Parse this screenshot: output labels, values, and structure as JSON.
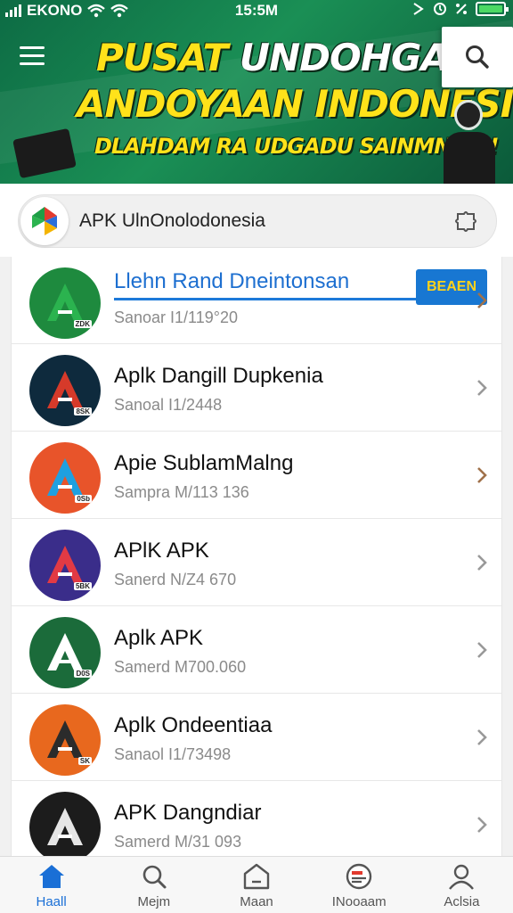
{
  "status_bar": {
    "carrier": "EKONO",
    "time": "15:5M"
  },
  "banner": {
    "line1_a": "PUSAT",
    "line1_b": "UNDOHGAN",
    "line2": "ANDOYAAN INDONESI!",
    "line3": "DLAHDAM RA UDGADU SAINMNAAI!"
  },
  "search": {
    "text": "APK UlnOnolodonesia"
  },
  "list": [
    {
      "title": "Llehn Rand Dneintonsan",
      "subtitle": "Sanoar I1/119°20",
      "tag": "ZDK",
      "color": "#1e8a3e",
      "accent": "#2bb34f",
      "button": "BEAEN"
    },
    {
      "title": "Aplk Dangill Dupkenia",
      "subtitle": "Sanoal I1/2448",
      "tag": "8SK",
      "color": "#0e2a3d",
      "accent": "#d63a2a"
    },
    {
      "title": "Apie SublamMalng",
      "subtitle": "Samprа M/113 136",
      "tag": "0Sb",
      "color": "#e8542a",
      "accent": "#1fa0e0"
    },
    {
      "title": "APlK APK",
      "subtitle": "Sanerd N/Z4 670",
      "tag": "5BK",
      "color": "#3a2d8a",
      "accent": "#e23a44"
    },
    {
      "title": "Aplk APK",
      "subtitle": "Samerd M700.060",
      "tag": "D0S",
      "color": "#1b6b3a",
      "accent": "#ffffff"
    },
    {
      "title": "Aplk Ondeentiaa",
      "subtitle": "Sanaol I1/73498",
      "tag": "SK",
      "color": "#e8681e",
      "accent": "#2b2b2b"
    },
    {
      "title": "APK Dangndiar",
      "subtitle": "Samerd M/31 093",
      "tag": "",
      "color": "#1c1c1c",
      "accent": "#e6e6e6"
    }
  ],
  "bottom_nav": [
    {
      "label": "Haall",
      "icon": "home-icon",
      "active": true
    },
    {
      "label": "Mejm",
      "icon": "search-icon",
      "active": false
    },
    {
      "label": "Maan",
      "icon": "store-icon",
      "active": false
    },
    {
      "label": "INooaam",
      "icon": "inbox-icon",
      "active": false
    },
    {
      "label": "Aclsia",
      "icon": "user-icon",
      "active": false
    }
  ],
  "colors": {
    "banner_green": "#1a8f55",
    "banner_text": "#ffe21a",
    "link_blue": "#1d6fd0",
    "nav_active": "#1a6fd6"
  }
}
